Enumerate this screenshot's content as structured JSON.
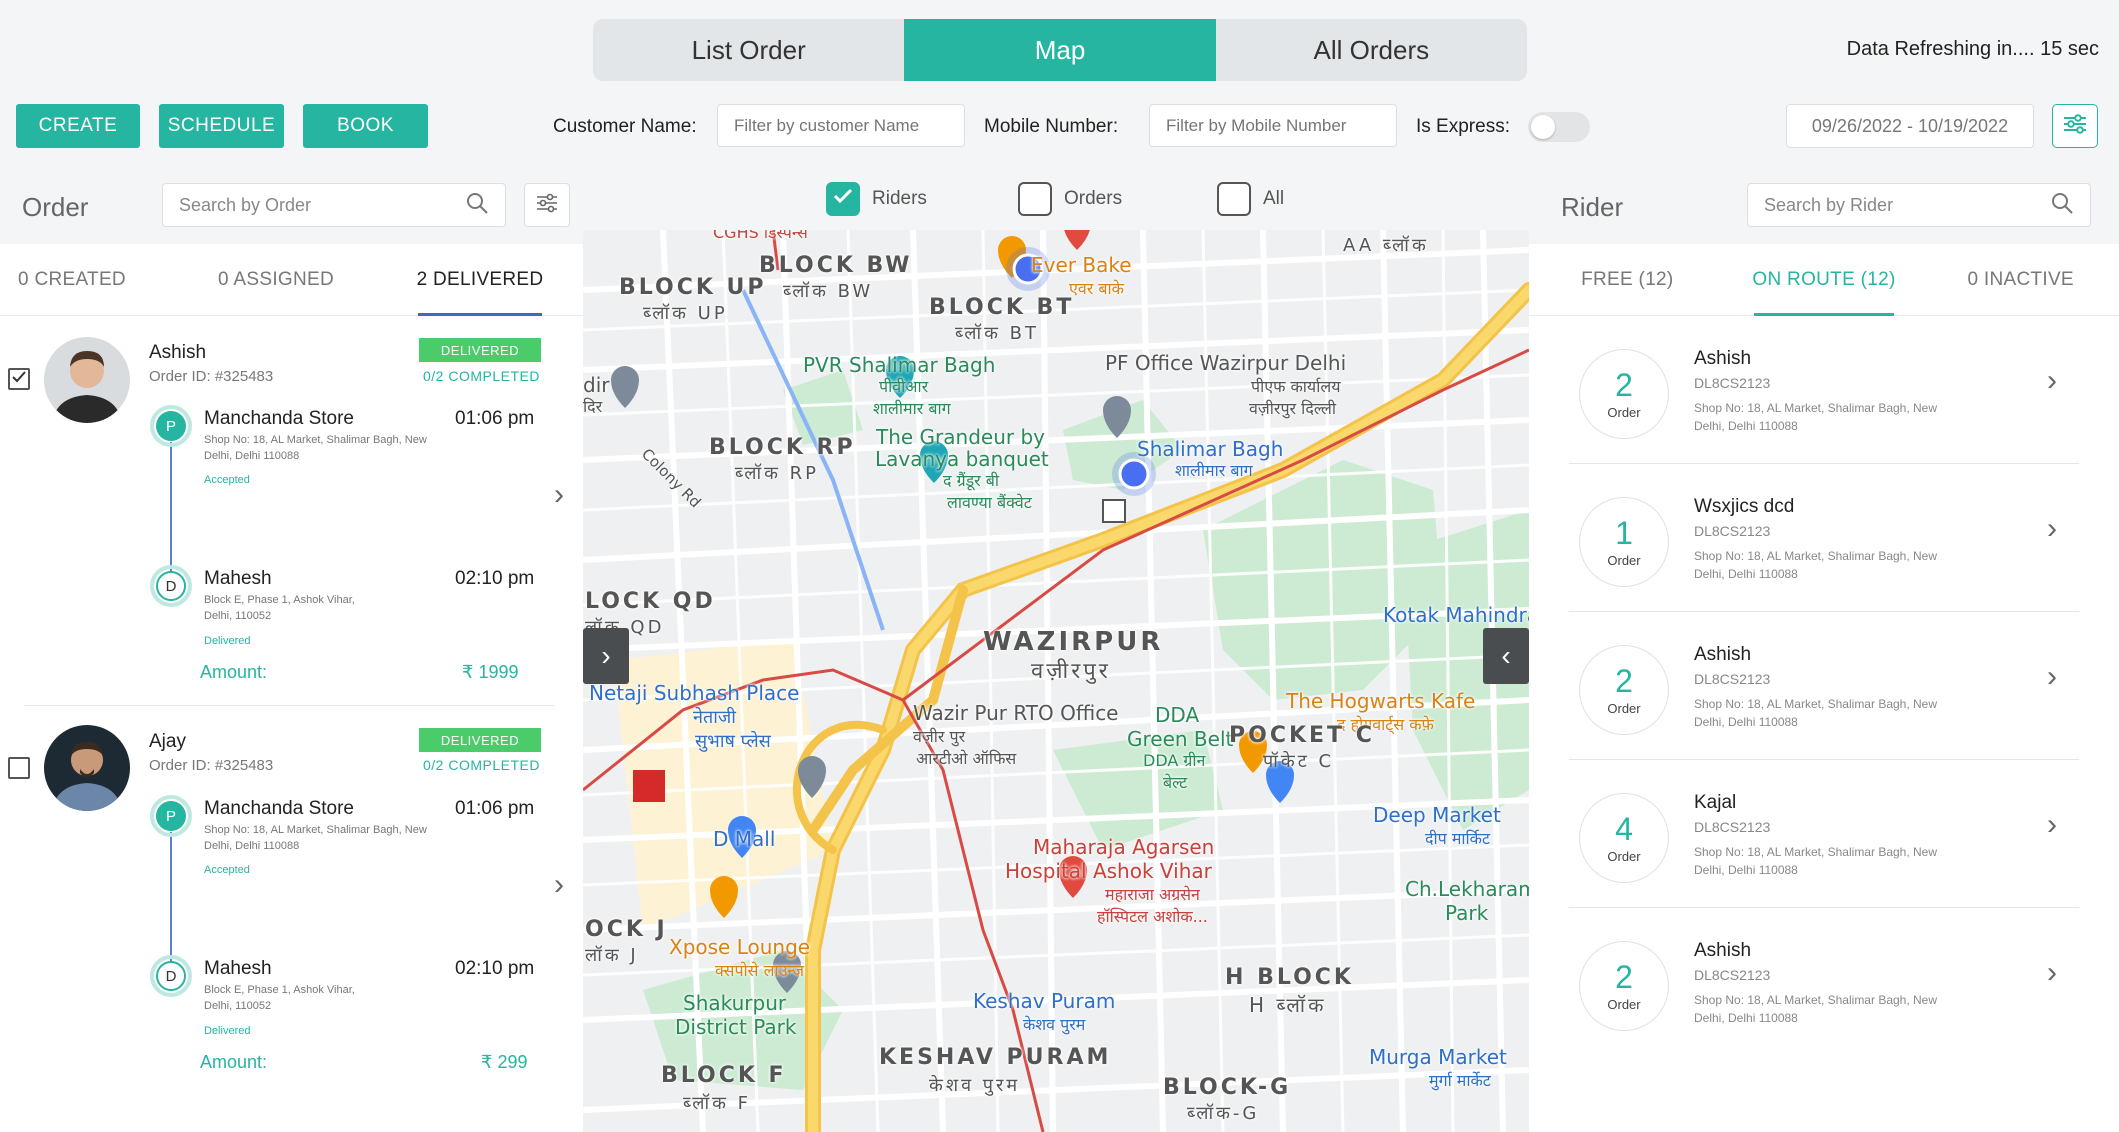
{
  "header": {
    "view_tabs": [
      "List Order",
      "Map",
      "All Orders"
    ],
    "refresh_text": "Data Refreshing in.... 15 sec",
    "buttons": {
      "create": "CREATE",
      "schedule": "SCHEDULE",
      "book": "BOOK"
    },
    "filters": {
      "customer_label": "Customer Name:",
      "customer_placeholder": "Filter by customer Name",
      "mobile_label": "Mobile Number:",
      "mobile_placeholder": "Filter by Mobile Number",
      "express_label": "Is Express:",
      "express_on": false,
      "date_range": "09/26/2022 - 10/19/2022"
    }
  },
  "order_panel": {
    "title": "Order",
    "search_placeholder": "Search by Order",
    "tabs": [
      "0 CREATED",
      "0 ASSIGNED",
      "2 DELIVERED"
    ],
    "orders": [
      {
        "name": "Ashish",
        "order_id": "Order ID: #325483",
        "status": "DELIVERED",
        "completed": "0/2 COMPLETED",
        "checked": true,
        "pickup": {
          "letter": "P",
          "name": "Manchanda Store",
          "time": "01:06 pm",
          "address": "Shop No: 18, AL Market, Shalimar Bagh, New Delhi, Delhi 110088",
          "status": "Accepted"
        },
        "drop": {
          "letter": "D",
          "name": "Mahesh",
          "time": "02:10 pm",
          "address": "Block E, Phase 1, Ashok Vihar, Delhi, 110052",
          "status": "Delivered"
        },
        "amount_label": "Amount:",
        "amount": "₹ 1999"
      },
      {
        "name": "Ajay",
        "order_id": "Order ID: #325483",
        "status": "DELIVERED",
        "completed": "0/2 COMPLETED",
        "checked": false,
        "pickup": {
          "letter": "P",
          "name": "Manchanda Store",
          "time": "01:06 pm",
          "address": "Shop No: 18, AL Market, Shalimar Bagh, New Delhi, Delhi 110088",
          "status": "Accepted"
        },
        "drop": {
          "letter": "D",
          "name": "Mahesh",
          "time": "02:10 pm",
          "address": "Block E, Phase 1, Ashok Vihar, Delhi, 110052",
          "status": "Delivered"
        },
        "amount_label": "Amount:",
        "amount": "₹ 299"
      }
    ]
  },
  "map": {
    "checkboxes": [
      {
        "label": "Riders",
        "checked": true
      },
      {
        "label": "Orders",
        "checked": false
      },
      {
        "label": "All",
        "checked": false
      }
    ],
    "labels": {
      "block_bw": "BLOCK BW",
      "block_bw_hi": "ब्लॉक BW",
      "block_up": "BLOCK UP",
      "block_up_hi": "ब्लॉक UP",
      "block_bt": "BLOCK BT",
      "block_bt_hi": "ब्लॉक BT",
      "block_rp": "BLOCK RP",
      "block_rp_hi": "ब्लॉक RP",
      "block_qd": "LOCK QD",
      "block_qd_hi": "लॉक QD",
      "block_j": "OCK J",
      "block_j_hi": "लॉक J",
      "block_f": "BLOCK F",
      "block_f_hi": "ब्लॉक F",
      "block_aa": "AA ब्लॉक",
      "wazirpur": "WAZIRPUR",
      "wazirpur_hi": "वज़ीरपुर",
      "pocket_c": "POCKET C",
      "pocket_c_hi": "पॉकेट C",
      "h_block": "H BLOCK",
      "h_block_hi": "H ब्लॉक",
      "keshav_puram": "KESHAV PURAM",
      "keshav_puram_hi": "केशव पुरम",
      "block_g": "BLOCK-G",
      "block_g_hi": "ब्लॉक-G",
      "ever_bake": "Ever Bake",
      "ever_bake_hi": "एवर बाके",
      "pvr": "PVR Shalimar Bagh",
      "pvr_hi": "पीवीआर",
      "pvr_hi2": "शालीमार बाग",
      "pf_office": "PF Office Wazirpur Delhi",
      "pf_office_hi": "पीएफ कार्यालय",
      "pf_office_hi2": "वज़ीरपुर दिल्ली",
      "grandeur": "The Grandeur by",
      "grandeur2": "Lavanya banquet",
      "grandeur_hi": "द ग्रैंडूर बी",
      "grandeur_hi2": "लावण्या बैंक्वेट",
      "shalimar_bagh": "Shalimar Bagh",
      "shalimar_bagh_hi": "शालीमार बाग",
      "kotak": "Kotak Mahindra",
      "netaji": "Netaji Subhash Place",
      "netaji_hi": "नेताजी",
      "netaji_hi2": "सुभाष प्लेस",
      "rto": "Wazir Pur RTO Office",
      "rto_hi": "वज़ीर पुर",
      "rto_hi2": "आरटीओ ऑफिस",
      "hogwarts": "The Hogwarts Kafe",
      "hogwarts_hi": "द होगवार्ट्स कफ़े",
      "dda": "DDA",
      "dda2": "Green Belt",
      "dda_hi": "DDA ग्रीन",
      "dda_hi2": "बेल्ट",
      "d_mall": "D Mall",
      "deep_market": "Deep Market",
      "deep_market_hi": "दीप मार्किट",
      "maharaja": "Maharaja Agarsen",
      "maharaja2": "Hospital Ashok Vihar",
      "maharaja_hi": "महाराजा अग्रसेन",
      "maharaja_hi2": "हॉस्पिटल अशोक...",
      "ch_lekharam": "Ch.Lekharam",
      "ch_lekharam2": "Park",
      "xpose": "Xpose Lounge",
      "xpose_hi": "क्सपोसे लाउन्ज",
      "shakurpur": "Shakurpur",
      "shakurpur2": "District Park",
      "keshav_puram_st": "Keshav Puram",
      "keshav_puram_st_hi": "केशव पुरम",
      "murga": "Murga Market",
      "murga_hi": "मुर्गा मार्केट",
      "colony_rd": "Colony Rd",
      "cghs": "CGHS डिस्पेन्स",
      "dir": "dir",
      "dir_hi": "दिर"
    }
  },
  "rider_panel": {
    "title": "Rider",
    "search_placeholder": "Search by Rider",
    "tabs": [
      "FREE (12)",
      "ON ROUTE (12)",
      "0 INACTIVE"
    ],
    "riders": [
      {
        "count": "2",
        "count_label": "Order",
        "name": "Ashish",
        "code": "DL8CS2123",
        "address": "Shop No: 18, AL Market, Shalimar Bagh, New Delhi, Delhi 110088"
      },
      {
        "count": "1",
        "count_label": "Order",
        "name": "Wsxjics dcd",
        "code": "DL8CS2123",
        "address": "Shop No: 18, AL Market, Shalimar Bagh, New Delhi, Delhi 110088"
      },
      {
        "count": "2",
        "count_label": "Order",
        "name": "Ashish",
        "code": "DL8CS2123",
        "address": "Shop No: 18, AL Market, Shalimar Bagh, New Delhi, Delhi 110088"
      },
      {
        "count": "4",
        "count_label": "Order",
        "name": "Kajal",
        "code": "DL8CS2123",
        "address": "Shop No: 18, AL Market, Shalimar Bagh, New Delhi, Delhi 110088"
      },
      {
        "count": "2",
        "count_label": "Order",
        "name": "Ashish",
        "code": "DL8CS2123",
        "address": "Shop No: 18, AL Market, Shalimar Bagh, New Delhi, Delhi 110088"
      }
    ]
  },
  "colors": {
    "accent": "#26b5a1",
    "badge_green": "#4ccb6a",
    "tab_underline": "#3f68c6"
  },
  "icons": [
    "search-icon",
    "sliders-icon",
    "check-icon",
    "chevron-right-icon",
    "chevron-left-icon",
    "rider-marker-icon",
    "poi-pin-icon"
  ]
}
